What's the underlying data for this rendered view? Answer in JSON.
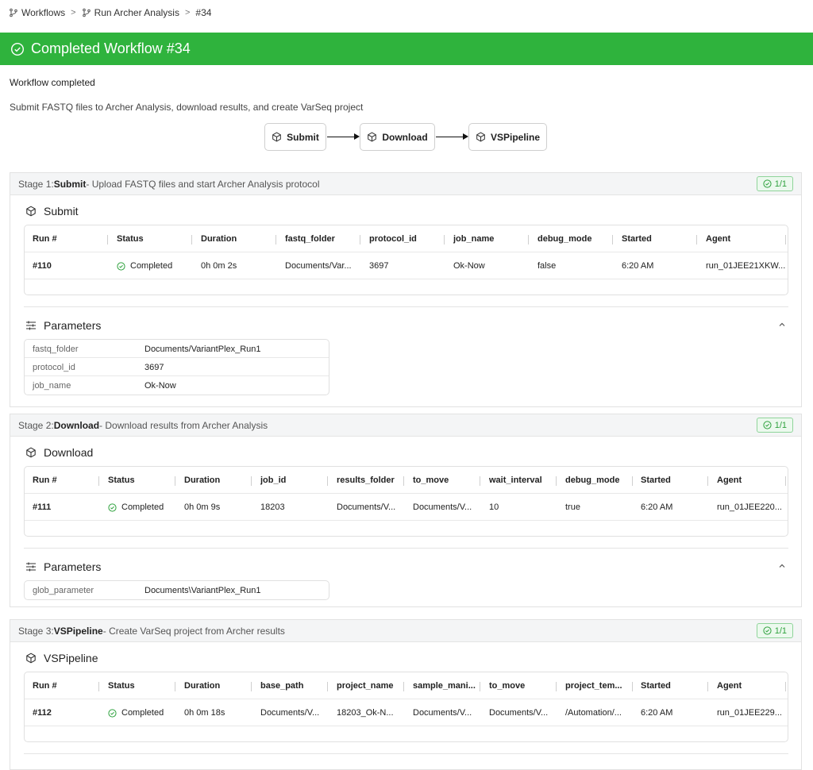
{
  "breadcrumb": {
    "root": "Workflows",
    "workflow": "Run Archer Analysis",
    "current": "#34"
  },
  "banner": {
    "title": "Completed Workflow #34",
    "color": "#2fb33d"
  },
  "status_text": "Workflow completed",
  "description": "Submit FASTQ files to Archer Analysis, download results, and create VarSeq project",
  "pipeline": [
    "Submit",
    "Download",
    "VSPipeline"
  ],
  "labels": {
    "parameters": "Parameters"
  },
  "stages": [
    {
      "prefix": "Stage 1: ",
      "name": "Submit",
      "desc": "- Upload FASTQ files and start Archer Analysis protocol",
      "badge": "1/1",
      "section": "Submit",
      "columns": [
        "Run #",
        "Status",
        "Duration",
        "fastq_folder",
        "protocol_id",
        "job_name",
        "debug_mode",
        "Started",
        "Agent"
      ],
      "rows": [
        [
          "#110",
          "Completed",
          "0h 0m 2s",
          "Documents/Var...",
          "3697",
          "Ok-Now",
          "false",
          "6:20 AM",
          "run_01JEE21XKW..."
        ]
      ],
      "params": [
        {
          "key": "fastq_folder",
          "value": "Documents/VariantPlex_Run1"
        },
        {
          "key": "protocol_id",
          "value": "3697"
        },
        {
          "key": "job_name",
          "value": "Ok-Now"
        }
      ]
    },
    {
      "prefix": "Stage 2: ",
      "name": "Download",
      "desc": "- Download results from Archer Analysis",
      "badge": "1/1",
      "section": "Download",
      "columns": [
        "Run #",
        "Status",
        "Duration",
        "job_id",
        "results_folder",
        "to_move",
        "wait_interval",
        "debug_mode",
        "Started",
        "Agent"
      ],
      "rows": [
        [
          "#111",
          "Completed",
          "0h 0m 9s",
          "18203",
          "Documents/V...",
          "Documents/V...",
          "10",
          "true",
          "6:20 AM",
          "run_01JEE220..."
        ]
      ],
      "params": [
        {
          "key": "glob_parameter",
          "value": "Documents\\VariantPlex_Run1"
        }
      ]
    },
    {
      "prefix": "Stage 3: ",
      "name": "VSPipeline",
      "desc": "- Create VarSeq project from Archer results",
      "badge": "1/1",
      "section": "VSPipeline",
      "columns": [
        "Run #",
        "Status",
        "Duration",
        "base_path",
        "project_name",
        "sample_mani...",
        "to_move",
        "project_tem...",
        "Started",
        "Agent"
      ],
      "rows": [
        [
          "#112",
          "Completed",
          "0h 0m 18s",
          "Documents/V...",
          "18203_Ok-N...",
          "Documents/V...",
          "Documents/V...",
          "/Automation/...",
          "6:20 AM",
          "run_01JEE229..."
        ]
      ],
      "params": []
    }
  ]
}
